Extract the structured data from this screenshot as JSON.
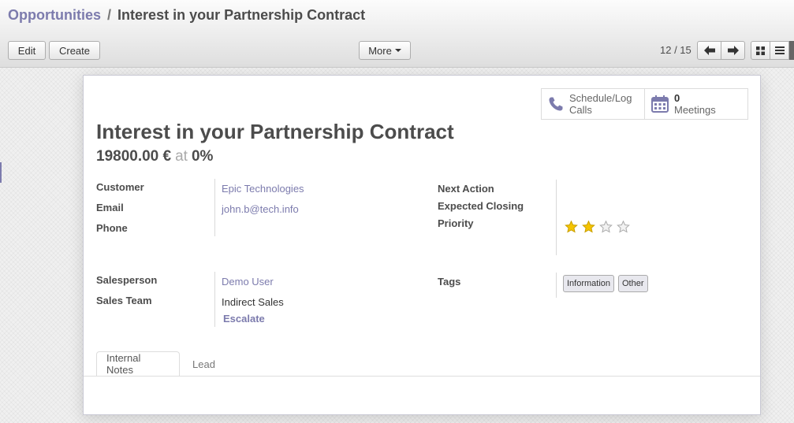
{
  "breadcrumb": {
    "parent": "Opportunities",
    "separator": "/",
    "current": "Interest in your Partnership Contract"
  },
  "toolbar": {
    "edit_label": "Edit",
    "create_label": "Create",
    "more_label": "More"
  },
  "pager": {
    "text": "12 / 15"
  },
  "view_switcher": {
    "icons": [
      "kanban-icon",
      "list-icon"
    ]
  },
  "smart_buttons": {
    "calls": {
      "icon": "phone-icon",
      "line1": "Schedule/Log",
      "line2": "Calls"
    },
    "meetings": {
      "icon": "calendar-icon",
      "count": "0",
      "label": "Meetings"
    }
  },
  "record": {
    "title": "Interest in your Partnership Contract",
    "revenue": "19800.00 €",
    "at": "at",
    "probability": "0",
    "percent": "%"
  },
  "fields": {
    "customer_label": "Customer",
    "customer_value": "Epic Technologies",
    "email_label": "Email",
    "email_value": "john.b@tech.info",
    "phone_label": "Phone",
    "next_action_label": "Next Action",
    "expected_closing_label": "Expected Closing",
    "priority_label": "Priority",
    "priority_value": 2,
    "priority_max": 4,
    "salesperson_label": "Salesperson",
    "salesperson_value": "Demo User",
    "sales_team_label": "Sales Team",
    "sales_team_value": "Indirect Sales",
    "escalate_label": "Escalate",
    "tags_label": "Tags",
    "tags": [
      "Information",
      "Other"
    ]
  },
  "tabs": [
    {
      "label": "Internal Notes",
      "active": true
    },
    {
      "label": "Lead",
      "active": false
    }
  ],
  "colors": {
    "accent": "#7c7bad",
    "star_filled": "#f5c400",
    "star_empty": "#cccccc"
  }
}
